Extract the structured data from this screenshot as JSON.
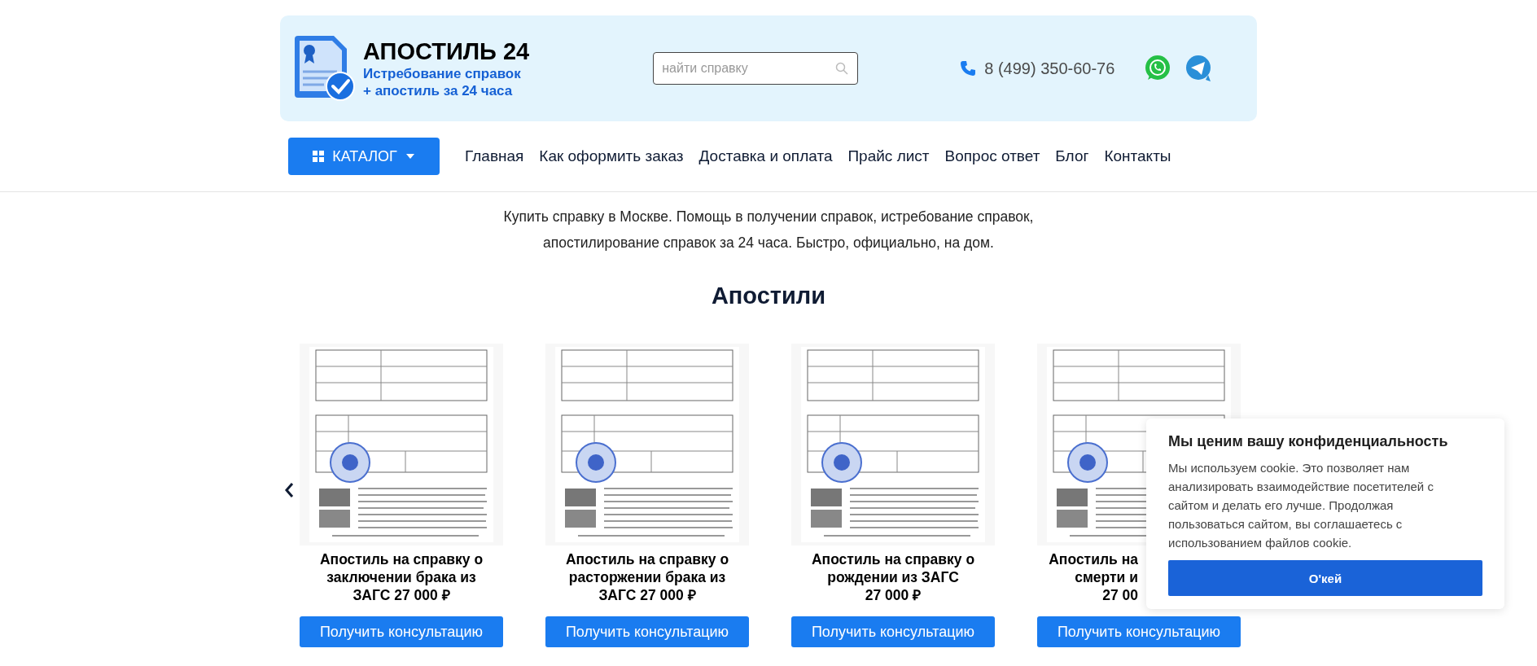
{
  "header": {
    "logo": {
      "title": "АПОСТИЛЬ 24",
      "subtitle_lines": [
        "Истребование справок",
        "+ апостиль за 24 часа"
      ]
    },
    "search": {
      "placeholder": "найти справку"
    },
    "phone": "8 (499) 350-60-76"
  },
  "nav": {
    "catalog_button": "КАТАЛОГ",
    "links": [
      "Главная",
      "Как оформить заказ",
      "Доставка и оплата",
      "Прайс лист",
      "Вопрос ответ",
      "Блог",
      "Контакты"
    ]
  },
  "intro": "Купить справку в Москве. Помощь в получении справок, истребование справок, апостилирование справок за 24 часа. Быстро, официально, на дом.",
  "section_title": "Апостили",
  "cards": [
    {
      "kind": "full",
      "title_lines": [
        "Апостиль на справку о",
        "заключении брака из",
        "ЗАГС 27 000 ₽"
      ],
      "button": "Получить консультацию"
    },
    {
      "kind": "full",
      "title_lines": [
        "Апостиль на справку о",
        "расторжении брака из",
        "ЗАГС 27 000 ₽"
      ],
      "button": "Получить консультацию"
    },
    {
      "kind": "full",
      "title_lines": [
        "Апостиль на справку о",
        "рождении из ЗАГС",
        "27 000 ₽"
      ],
      "button": "Получить консультацию"
    },
    {
      "kind": "covered",
      "title_lines": [
        "Апостиль на",
        "смерти и",
        "27 00"
      ],
      "button": "Получить консультацию"
    }
  ],
  "cookie_notice": {
    "title": "Мы ценим вашу конфиденциальность",
    "text": "Мы используем cookie. Это позволяет нам анализировать взаимодействие посетителей с сайтом и делать его лучше. Продолжая пользоваться сайтом, вы соглашаетесь с использованием файлов cookie.",
    "button": "О'кей"
  }
}
